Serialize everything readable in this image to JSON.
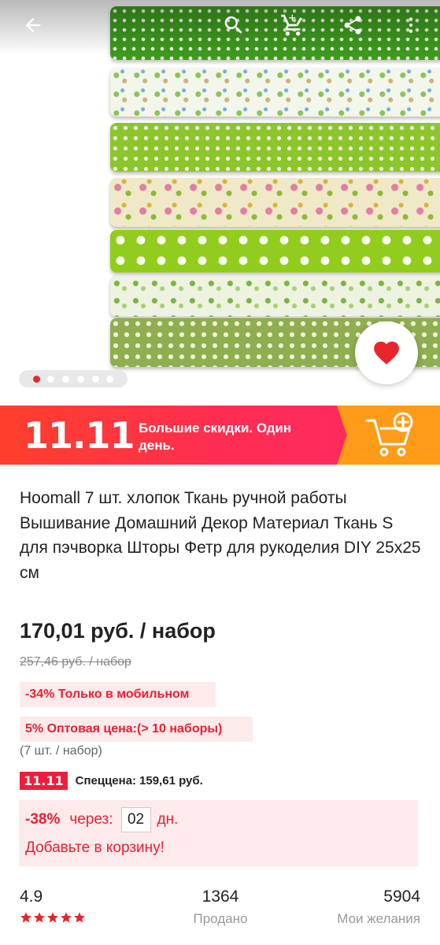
{
  "promo": {
    "logo": "11.11",
    "text": "Большие скидки. Один день."
  },
  "product": {
    "title": "Hoomall 7 шт. хлопок Ткань ручной работы Вышивание Домашний Декор Материал Ткань S для пэчворка Шторы Фетр для рукоделия DIY 25x25 см",
    "price": "170,01 руб. / набор",
    "old_price": "257,46 руб. / набор",
    "mobile_discount": "-34%  Только в мобильном",
    "wholesale": "5%  Оптовая цена:(> 10 наборы)",
    "pack_info": "(7 шт. / набор)"
  },
  "special_price": {
    "badge": "11.11",
    "label": "Спеццена:",
    "value": "159,61 руб."
  },
  "countdown": {
    "discount": "-38%",
    "through": "через:",
    "days": "02",
    "days_unit": "дн.",
    "cta": "Добавьте в корзину!"
  },
  "stats": {
    "rating": "4.9",
    "stars": 5,
    "sold_count": "1364",
    "sold_label": "Продано",
    "wishlist_count": "5904",
    "wishlist_label": "Мои желания"
  },
  "gallery": {
    "total_images": 6,
    "active_index": 0
  },
  "colors": {
    "accent_red": "#e62234",
    "promo_red": "#ff2c55",
    "promo_orange": "#ff9b17",
    "tag_bg": "#fdeaea"
  }
}
